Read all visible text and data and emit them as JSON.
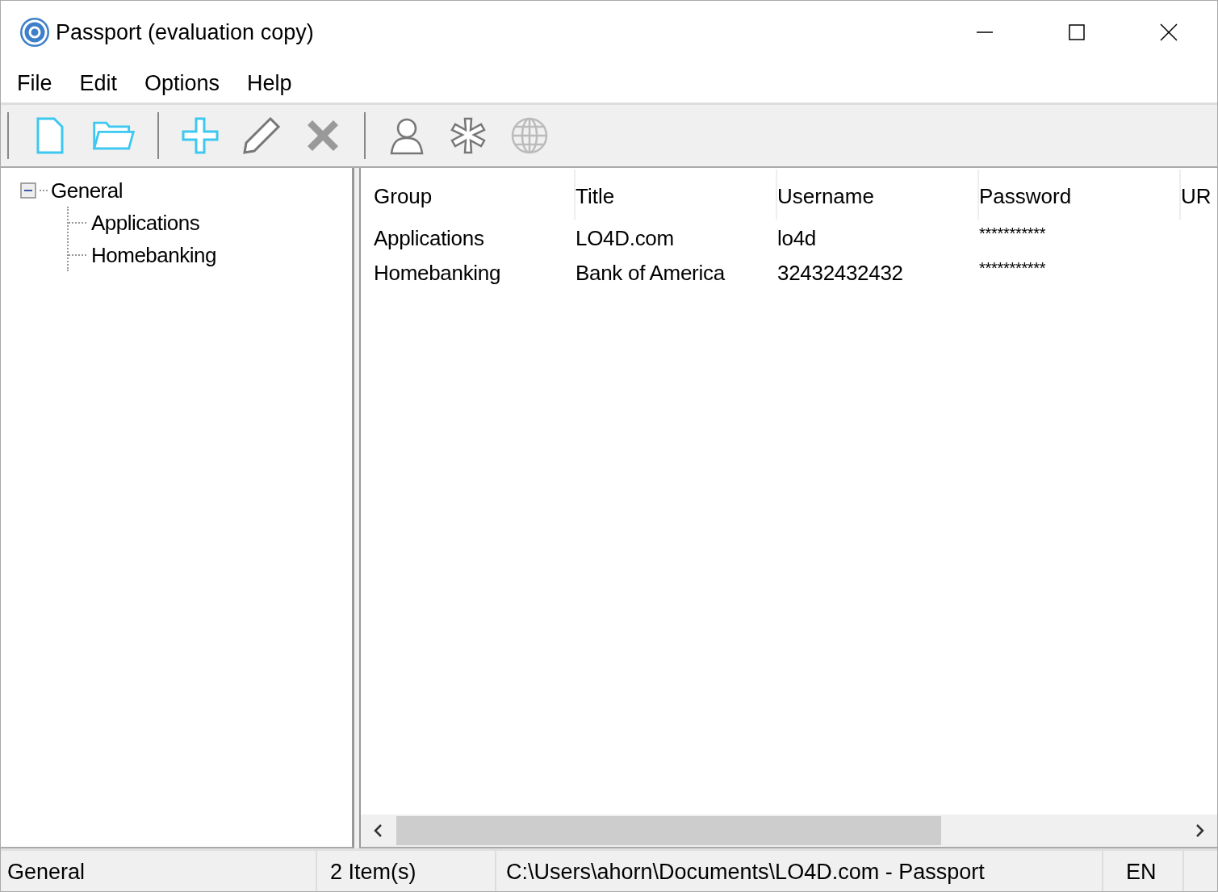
{
  "window": {
    "title": "Passport (evaluation copy)"
  },
  "menu": [
    "File",
    "Edit",
    "Options",
    "Help"
  ],
  "toolbar": [
    {
      "kind": "separator"
    },
    {
      "kind": "new"
    },
    {
      "kind": "open"
    },
    {
      "kind": "separator"
    },
    {
      "kind": "add"
    },
    {
      "kind": "edit"
    },
    {
      "kind": "delete"
    },
    {
      "kind": "separator"
    },
    {
      "kind": "user"
    },
    {
      "kind": "asterisk"
    },
    {
      "kind": "globe"
    }
  ],
  "tree": [
    {
      "label": "General",
      "expanded": true,
      "children": [
        {
          "label": "Applications"
        },
        {
          "label": "Homebanking"
        }
      ]
    }
  ],
  "table": {
    "columns": [
      "Group",
      "Title",
      "Username",
      "Password",
      "UR"
    ],
    "rows": [
      [
        "Applications",
        "LO4D.com",
        "lo4d",
        "***********"
      ],
      [
        "Homebanking",
        "Bank of America",
        "32432432432",
        "***********"
      ]
    ]
  },
  "status_bar": [
    "General",
    "2 Item(s)",
    "C:\\Users\\ahorn\\Documents\\LO4D.com - Passport",
    "EN"
  ]
}
